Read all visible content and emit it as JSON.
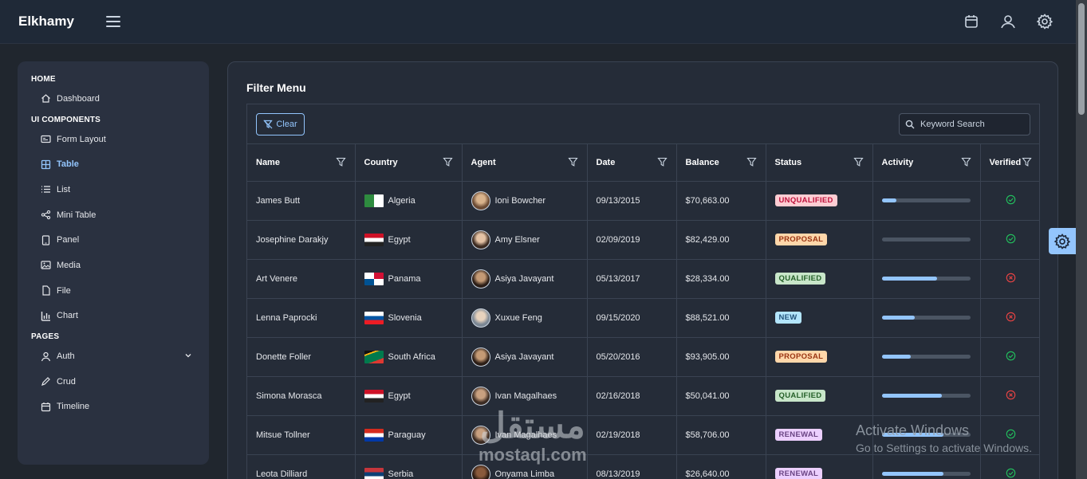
{
  "app": {
    "title": "Elkhamy"
  },
  "sidebar": {
    "sections": [
      {
        "label": "HOME",
        "items": [
          {
            "label": "Dashboard",
            "icon": "home-icon"
          }
        ]
      },
      {
        "label": "UI COMPONENTS",
        "items": [
          {
            "label": "Form Layout",
            "icon": "id-card-icon"
          },
          {
            "label": "Table",
            "icon": "table-icon",
            "active": true
          },
          {
            "label": "List",
            "icon": "list-icon"
          },
          {
            "label": "Mini Table",
            "icon": "share-icon"
          },
          {
            "label": "Panel",
            "icon": "tablet-icon"
          },
          {
            "label": "Media",
            "icon": "image-icon"
          },
          {
            "label": "File",
            "icon": "file-icon"
          },
          {
            "label": "Chart",
            "icon": "chart-bar-icon"
          }
        ]
      },
      {
        "label": "PAGES",
        "items": [
          {
            "label": "Auth",
            "icon": "user-icon",
            "expandable": true
          },
          {
            "label": "Crud",
            "icon": "pencil-icon"
          },
          {
            "label": "Timeline",
            "icon": "calendar-icon"
          }
        ]
      }
    ]
  },
  "main": {
    "title": "Filter Menu",
    "clear_label": "Clear",
    "search_placeholder": "Keyword Search",
    "columns": [
      "Name",
      "Country",
      "Agent",
      "Date",
      "Balance",
      "Status",
      "Activity",
      "Verified"
    ],
    "rows": [
      {
        "name": "James Butt",
        "country": "Algeria",
        "agent": "Ioni Bowcher",
        "date": "09/13/2015",
        "balance": "$70,663.00",
        "status": "UNQUALIFIED",
        "activity": 0.17,
        "verified": true
      },
      {
        "name": "Josephine Darakjy",
        "country": "Egypt",
        "agent": "Amy Elsner",
        "date": "02/09/2019",
        "balance": "$82,429.00",
        "status": "PROPOSAL",
        "activity": 0.0,
        "verified": true
      },
      {
        "name": "Art Venere",
        "country": "Panama",
        "agent": "Asiya Javayant",
        "date": "05/13/2017",
        "balance": "$28,334.00",
        "status": "QUALIFIED",
        "activity": 0.63,
        "verified": false
      },
      {
        "name": "Lenna Paprocki",
        "country": "Slovenia",
        "agent": "Xuxue Feng",
        "date": "09/15/2020",
        "balance": "$88,521.00",
        "status": "NEW",
        "activity": 0.37,
        "verified": false
      },
      {
        "name": "Donette Foller",
        "country": "South Africa",
        "agent": "Asiya Javayant",
        "date": "05/20/2016",
        "balance": "$93,905.00",
        "status": "PROPOSAL",
        "activity": 0.33,
        "verified": true
      },
      {
        "name": "Simona Morasca",
        "country": "Egypt",
        "agent": "Ivan Magalhaes",
        "date": "02/16/2018",
        "balance": "$50,041.00",
        "status": "QUALIFIED",
        "activity": 0.68,
        "verified": false
      },
      {
        "name": "Mitsue Tollner",
        "country": "Paraguay",
        "agent": "Ivan Magalhaes",
        "date": "02/19/2018",
        "balance": "$58,706.00",
        "status": "RENEWAL",
        "activity": 0.7,
        "verified": true
      },
      {
        "name": "Leota Dilliard",
        "country": "Serbia",
        "agent": "Onyama Limba",
        "date": "08/13/2019",
        "balance": "$26,640.00",
        "status": "RENEWAL",
        "activity": 0.7,
        "verified": true
      }
    ]
  },
  "status_colors": {
    "UNQUALIFIED": {
      "bg": "#fecdd3",
      "fg": "#be123c"
    },
    "PROPOSAL": {
      "bg": "#fed7aa",
      "fg": "#9a3412"
    },
    "QUALIFIED": {
      "bg": "#c8e6c9",
      "fg": "#256029"
    },
    "NEW": {
      "bg": "#b3e5fc",
      "fg": "#23547b"
    },
    "RENEWAL": {
      "bg": "#eccfff",
      "fg": "#694382"
    }
  },
  "watermark": {
    "line1": "Activate Windows",
    "line2": "Go to Settings to activate Windows.",
    "brand_ar": "مستقل",
    "brand_en": "mostaql.com"
  },
  "accent": "#93c5fd"
}
